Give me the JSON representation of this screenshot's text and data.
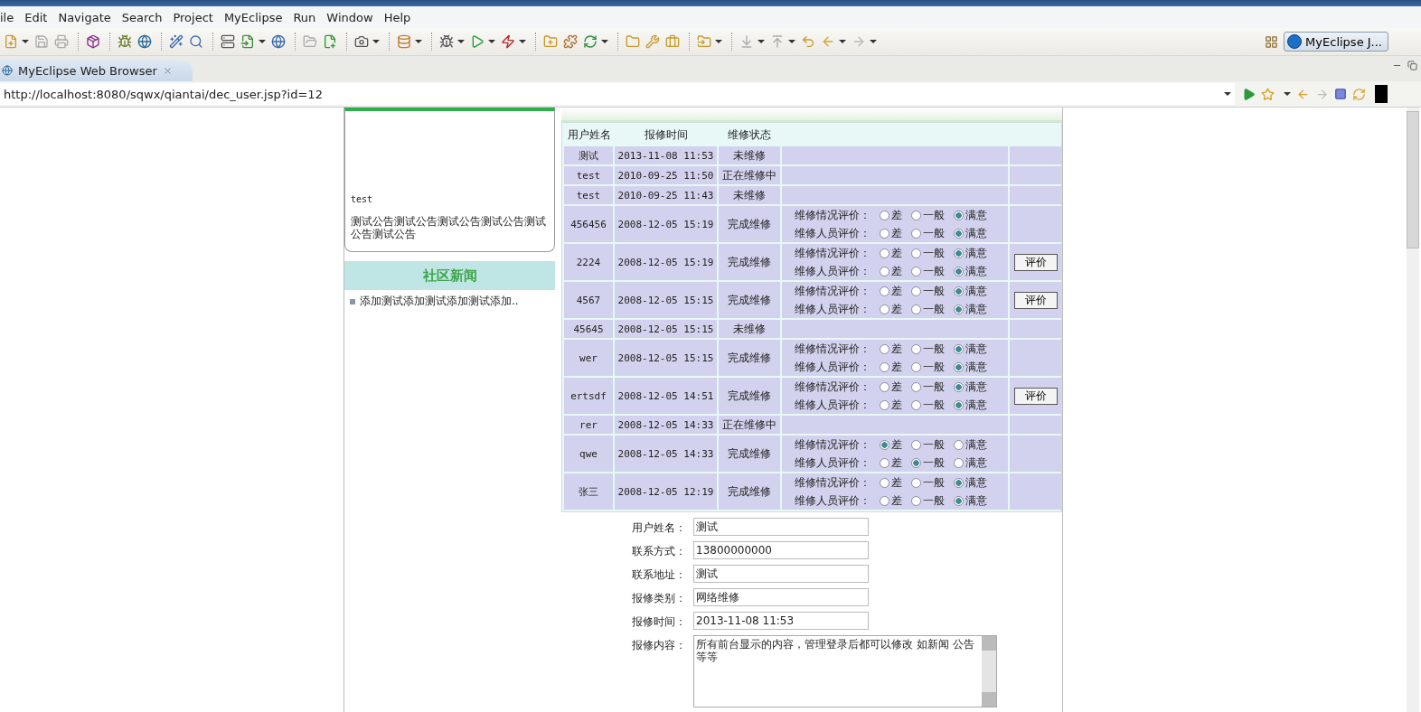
{
  "menu": [
    "ile",
    "Edit",
    "Navigate",
    "Search",
    "Project",
    "MyEclipse",
    "Run",
    "Window",
    "Help"
  ],
  "perspective_button": "MyEclipse J...",
  "editor_tab": {
    "label": "MyEclipse Web Browser",
    "selected": true
  },
  "address": {
    "value": "http://localhost:8080/sqwx/qiantai/dec_user.jsp?id=12"
  },
  "notice": {
    "title": "test",
    "body": "测试公告测试公告测试公告测试公告测试公告测试公告"
  },
  "news": {
    "title": "社区新闻",
    "items": [
      "添加测试添加测试添加测试添加.."
    ]
  },
  "repairs": {
    "columns": [
      "用户姓名",
      "报修时间",
      "维修状态"
    ],
    "rows": [
      {
        "name": "测试",
        "time": "2013-11-08 11:53",
        "status": "未维修"
      },
      {
        "name": "test",
        "time": "2010-09-25 11:50",
        "status": "正在维修中"
      },
      {
        "name": "test",
        "time": "2010-09-25 11:43",
        "status": "未维修"
      },
      {
        "name": "456456",
        "time": "2008-12-05 15:19",
        "status": "完成维修",
        "ratings": [
          {
            "label": "维修情况评价：",
            "options": [
              {
                "label": "差",
                "selected": false
              },
              {
                "label": "一般",
                "selected": false
              },
              {
                "label": "满意",
                "selected": true
              }
            ]
          },
          {
            "label": "维修人员评价：",
            "options": [
              {
                "label": "差",
                "selected": false
              },
              {
                "label": "一般",
                "selected": false
              },
              {
                "label": "满意",
                "selected": true
              }
            ]
          }
        ]
      },
      {
        "name": "2224",
        "time": "2008-12-05 15:19",
        "status": "完成维修",
        "button": "评价",
        "ratings": [
          {
            "label": "维修情况评价：",
            "options": [
              {
                "label": "差",
                "selected": false
              },
              {
                "label": "一般",
                "selected": false
              },
              {
                "label": "满意",
                "selected": true
              }
            ]
          },
          {
            "label": "维修人员评价：",
            "options": [
              {
                "label": "差",
                "selected": false
              },
              {
                "label": "一般",
                "selected": false
              },
              {
                "label": "满意",
                "selected": true
              }
            ]
          }
        ]
      },
      {
        "name": "4567",
        "time": "2008-12-05 15:15",
        "status": "完成维修",
        "button": "评价",
        "ratings": [
          {
            "label": "维修情况评价：",
            "options": [
              {
                "label": "差",
                "selected": false
              },
              {
                "label": "一般",
                "selected": false
              },
              {
                "label": "满意",
                "selected": true
              }
            ]
          },
          {
            "label": "维修人员评价：",
            "options": [
              {
                "label": "差",
                "selected": false
              },
              {
                "label": "一般",
                "selected": false
              },
              {
                "label": "满意",
                "selected": true
              }
            ]
          }
        ]
      },
      {
        "name": "45645",
        "time": "2008-12-05 15:15",
        "status": "未维修"
      },
      {
        "name": "wer",
        "time": "2008-12-05 15:15",
        "status": "完成维修",
        "ratings": [
          {
            "label": "维修情况评价：",
            "options": [
              {
                "label": "差",
                "selected": false
              },
              {
                "label": "一般",
                "selected": false
              },
              {
                "label": "满意",
                "selected": true
              }
            ]
          },
          {
            "label": "维修人员评价：",
            "options": [
              {
                "label": "差",
                "selected": false
              },
              {
                "label": "一般",
                "selected": false
              },
              {
                "label": "满意",
                "selected": true
              }
            ]
          }
        ]
      },
      {
        "name": "ertsdf",
        "time": "2008-12-05 14:51",
        "status": "完成维修",
        "button": "评价",
        "ratings": [
          {
            "label": "维修情况评价：",
            "options": [
              {
                "label": "差",
                "selected": false
              },
              {
                "label": "一般",
                "selected": false
              },
              {
                "label": "满意",
                "selected": true
              }
            ]
          },
          {
            "label": "维修人员评价：",
            "options": [
              {
                "label": "差",
                "selected": false
              },
              {
                "label": "一般",
                "selected": false
              },
              {
                "label": "满意",
                "selected": true
              }
            ]
          }
        ]
      },
      {
        "name": "rer",
        "time": "2008-12-05 14:33",
        "status": "正在维修中"
      },
      {
        "name": "qwe",
        "time": "2008-12-05 14:33",
        "status": "完成维修",
        "ratings": [
          {
            "label": "维修情况评价：",
            "options": [
              {
                "label": "差",
                "selected": true
              },
              {
                "label": "一般",
                "selected": false
              },
              {
                "label": "满意",
                "selected": false
              }
            ]
          },
          {
            "label": "维修人员评价：",
            "options": [
              {
                "label": "差",
                "selected": false
              },
              {
                "label": "一般",
                "selected": true
              },
              {
                "label": "满意",
                "selected": false
              }
            ]
          }
        ]
      },
      {
        "name": "张三",
        "time": "2008-12-05 12:19",
        "status": "完成维修",
        "ratings": [
          {
            "label": "维修情况评价：",
            "options": [
              {
                "label": "差",
                "selected": false
              },
              {
                "label": "一般",
                "selected": false
              },
              {
                "label": "满意",
                "selected": true
              }
            ]
          },
          {
            "label": "维修人员评价：",
            "options": [
              {
                "label": "差",
                "selected": false
              },
              {
                "label": "一般",
                "selected": false
              },
              {
                "label": "满意",
                "selected": true
              }
            ]
          }
        ]
      }
    ]
  },
  "detail": {
    "fields": [
      {
        "label": "用户姓名：",
        "value": "测试"
      },
      {
        "label": "联系方式：",
        "value": "13800000000"
      },
      {
        "label": "联系地址：",
        "value": "测试"
      },
      {
        "label": "报修类别：",
        "value": "网络维修"
      },
      {
        "label": "报修时间：",
        "value": "2013-11-08 11:53"
      }
    ],
    "content": {
      "label": "报修内容：",
      "value": "所有前台显示的内容，管理登录后都可以修改 如新闻 公告等等"
    }
  }
}
